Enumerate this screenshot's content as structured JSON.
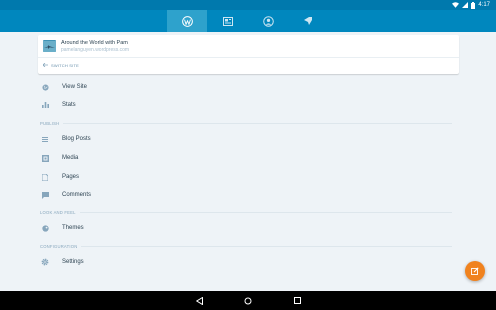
{
  "status_bar": {
    "time": "4:17",
    "wifi_icon": "wifi-icon",
    "signal_icon": "signal-icon",
    "battery_icon": "battery-icon"
  },
  "tabs": [
    {
      "icon": "wordpress-icon",
      "active": true
    },
    {
      "icon": "reader-icon",
      "active": false
    },
    {
      "icon": "me-icon",
      "active": false
    },
    {
      "icon": "notifications-icon",
      "active": false
    }
  ],
  "site": {
    "title": "Around the World with Pam",
    "url": "pamelanguyen.wordpress.com",
    "switch_label": "SWITCH SITE"
  },
  "menu": {
    "view_site": "View Site",
    "stats": "Stats",
    "publish_header": "PUBLISH",
    "blog_posts": "Blog Posts",
    "media": "Media",
    "pages": "Pages",
    "comments": "Comments",
    "look_header": "LOOK AND FEEL",
    "themes": "Themes",
    "config_header": "CONFIGURATION",
    "settings": "Settings"
  },
  "colors": {
    "accent": "#0087be",
    "status": "#0079ad",
    "fab": "#f0821e",
    "background": "#eef3f7"
  },
  "fab_icon": "compose-icon",
  "nav": {
    "back_icon": "back-icon",
    "home_icon": "home-icon",
    "recents_icon": "recents-icon"
  }
}
